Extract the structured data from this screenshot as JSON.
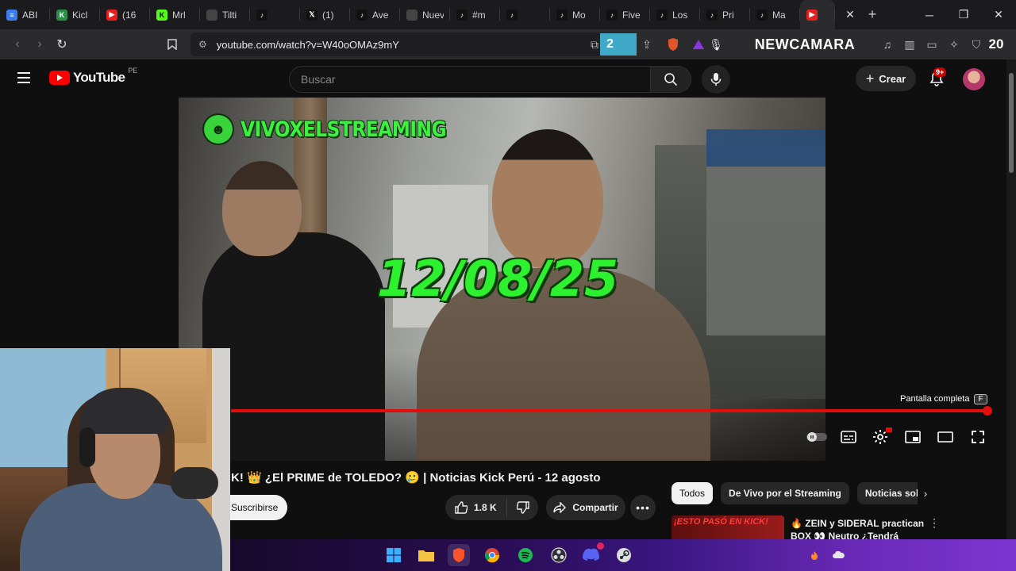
{
  "browser": {
    "tabs": [
      {
        "label": "ABI",
        "icon": "docs-icon",
        "color": "#3b7ded"
      },
      {
        "label": "Kicl",
        "icon": "kick-app-icon",
        "color": "#2c8c4a"
      },
      {
        "label": "(16",
        "icon": "youtube-icon",
        "color": "#e52020"
      },
      {
        "label": "Mrl",
        "icon": "kick-icon",
        "color": "#53fc18"
      },
      {
        "label": "Tilti",
        "icon": "blank-icon",
        "color": "#444444"
      },
      {
        "label": "",
        "icon": "tiktok-icon",
        "color": "#111111"
      },
      {
        "label": "(1)",
        "icon": "x-icon",
        "color": "#111111"
      },
      {
        "label": "Ave",
        "icon": "tiktok-icon",
        "color": "#111111"
      },
      {
        "label": "Nueva p",
        "icon": "blank-icon",
        "color": "#444444"
      },
      {
        "label": "#m",
        "icon": "tiktok-icon",
        "color": "#111111"
      },
      {
        "label": "",
        "icon": "tiktok-icon",
        "color": "#111111"
      },
      {
        "label": "Mo",
        "icon": "tiktok-icon",
        "color": "#111111"
      },
      {
        "label": "Five",
        "icon": "tiktok-icon",
        "color": "#111111"
      },
      {
        "label": "Los",
        "icon": "tiktok-icon",
        "color": "#111111"
      },
      {
        "label": "Pri",
        "icon": "tiktok-icon",
        "color": "#111111"
      },
      {
        "label": "Ma",
        "icon": "tiktok-icon",
        "color": "#111111"
      }
    ],
    "active_tab_icon": "youtube-icon",
    "url": "youtube.com/watch?v=W40oOMAz9mY",
    "overlay_badge": "2",
    "overlay_brand": "NEWCAMARA",
    "overlay_number": "20"
  },
  "youtube": {
    "logo_text": "YouTube",
    "region": "PE",
    "search_placeholder": "Buscar",
    "create_label": "Crear",
    "notif_badge": "9+",
    "video": {
      "channel_overlay": "VIVOXELSTREAMING",
      "date_overlay": "12/08/25",
      "fullscreen_tip": "Pantalla completa",
      "fullscreen_key": "F",
      "progress": 1.0
    },
    "title": "K! 👑 ¿El PRIME de TOLEDO? 🥲 | Noticias Kick Perú - 12 agosto",
    "subscribe_label": "Suscribirse",
    "like_count": "1.8 K",
    "share_label": "Compartir",
    "chips": [
      "Todos",
      "De Vivo por el Streaming",
      "Noticias sob"
    ],
    "recommendation": {
      "thumb_text": "¡ESTO PASÓ EN KICK!",
      "title": "🔥 ZEIN y SIDERAL practican BOX 👀 Neutro ¿Tendrá"
    }
  },
  "colors": {
    "yt_red": "#ff0000",
    "progress": "#e40d0d",
    "overlay_green": "#2df02f"
  }
}
